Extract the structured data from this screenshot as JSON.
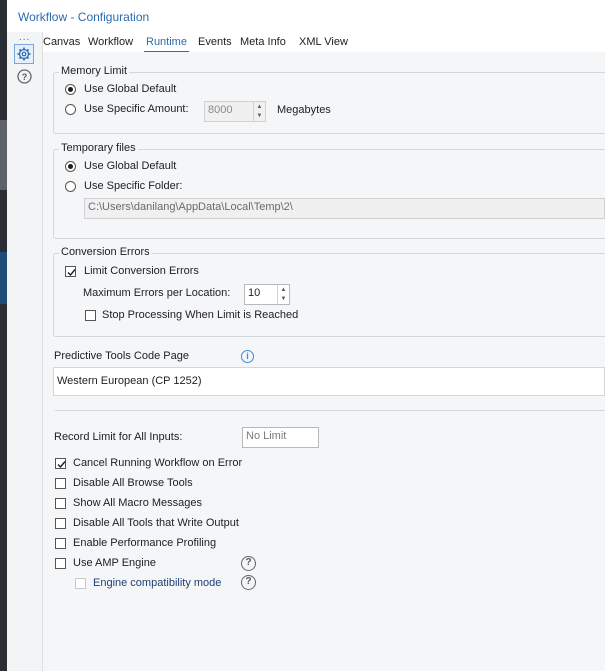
{
  "window": {
    "title": "Workflow - Configuration"
  },
  "tabs": [
    "Canvas",
    "Workflow",
    "Runtime",
    "Events",
    "Meta Info",
    "XML View"
  ],
  "active_tab": "Runtime",
  "memory": {
    "legend": "Memory Limit",
    "global_label": "Use Global Default",
    "specific_label": "Use Specific Amount:",
    "amount": "8000",
    "unit": "Megabytes"
  },
  "temp": {
    "legend": "Temporary files",
    "global_label": "Use Global Default",
    "specific_label": "Use Specific Folder:",
    "folder": "C:\\Users\\danilang\\AppData\\Local\\Temp\\2\\"
  },
  "conversion": {
    "legend": "Conversion Errors",
    "limit_label": "Limit Conversion Errors",
    "max_label": "Maximum Errors per Location:",
    "max_value": "10",
    "stop_label": "Stop Processing When Limit is Reached"
  },
  "predictive": {
    "label": "Predictive Tools Code Page",
    "value": "Western European (CP 1252)"
  },
  "record_limit": {
    "label": "Record Limit for All Inputs:",
    "placeholder": "No Limit"
  },
  "options": {
    "cancel": "Cancel Running Workflow on Error",
    "browse": "Disable All Browse Tools",
    "macro": "Show All Macro Messages",
    "write": "Disable All Tools that Write Output",
    "profiling": "Enable Performance Profiling",
    "amp": "Use AMP Engine",
    "compat": "Engine compatibility mode"
  },
  "glyphs": {
    "dots": "...",
    "info": "i",
    "question": "?"
  },
  "colors": {
    "accent": "#2b6cb0",
    "info": "#3d8fd6"
  }
}
